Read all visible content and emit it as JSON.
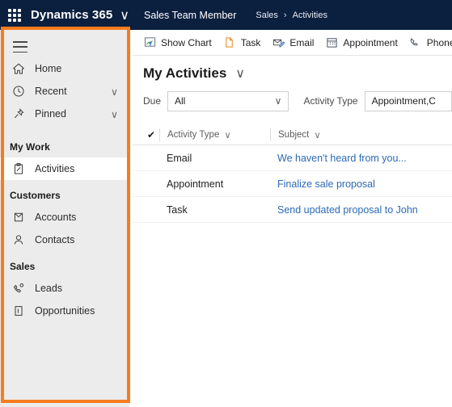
{
  "header": {
    "waffle_icon": "app-launcher-icon",
    "brand": "Dynamics 365",
    "brand_caret": "∨",
    "app_name": "Sales Team Member",
    "breadcrumb": {
      "parent": "Sales",
      "separator": "›",
      "current": "Activities"
    }
  },
  "sidebar": {
    "menu_icon": "hamburger-icon",
    "items": [
      {
        "label": "Home",
        "icon": "home-icon",
        "caret": "",
        "selected": false
      },
      {
        "label": "Recent",
        "icon": "clock-icon",
        "caret": "∨",
        "selected": false
      },
      {
        "label": "Pinned",
        "icon": "pin-icon",
        "caret": "∨",
        "selected": false
      }
    ],
    "groups": [
      {
        "label": "My Work",
        "items": [
          {
            "label": "Activities",
            "icon": "clipboard-icon",
            "selected": true
          }
        ]
      },
      {
        "label": "Customers",
        "items": [
          {
            "label": "Accounts",
            "icon": "account-icon",
            "selected": false
          },
          {
            "label": "Contacts",
            "icon": "contact-icon",
            "selected": false
          }
        ]
      },
      {
        "label": "Sales",
        "items": [
          {
            "label": "Leads",
            "icon": "lead-icon",
            "selected": false
          },
          {
            "label": "Opportunities",
            "icon": "opportunity-icon",
            "selected": false
          }
        ]
      }
    ]
  },
  "commandbar": {
    "buttons": [
      {
        "label": "Show Chart",
        "icon": "chart-icon"
      },
      {
        "label": "Task",
        "icon": "task-document-icon"
      },
      {
        "label": "Email",
        "icon": "email-envelope-icon"
      },
      {
        "label": "Appointment",
        "icon": "calendar-icon"
      },
      {
        "label": "Phone Call",
        "icon": "phone-icon"
      }
    ]
  },
  "view": {
    "title": "My Activities",
    "caret": "∨"
  },
  "filters": {
    "due": {
      "label": "Due",
      "value": "All",
      "caret": "∨"
    },
    "activity_type": {
      "label": "Activity Type",
      "value": "Appointment,C"
    }
  },
  "grid": {
    "select_all_icon": "checkmark-icon",
    "columns": [
      {
        "label": "Activity Type",
        "caret": "∨"
      },
      {
        "label": "Subject",
        "caret": "∨"
      }
    ],
    "rows": [
      {
        "type": "Email",
        "subject": "We haven't heard from you..."
      },
      {
        "type": "Appointment",
        "subject": "Finalize sale proposal"
      },
      {
        "type": "Task",
        "subject": "Send updated proposal to John"
      }
    ]
  },
  "annotation": {
    "color": "#f57c1f",
    "target": "sidebar-sitemap"
  }
}
